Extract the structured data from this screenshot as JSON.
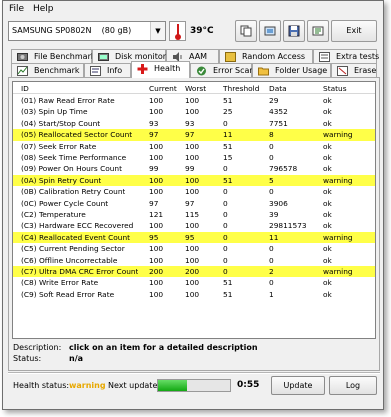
{
  "menu": {
    "file": "File",
    "help": "Help"
  },
  "toolbar": {
    "drive": "SAMSUNG SP0802N    (80 gB)",
    "temperature": "39°C",
    "exit_label": "Exit"
  },
  "tabs_row1": [
    {
      "label": "File Benchmark",
      "icon": "disk-icon"
    },
    {
      "label": "Disk monitor",
      "icon": "monitor-icon"
    },
    {
      "label": "AAM",
      "icon": "speaker-icon"
    },
    {
      "label": "Random Access",
      "icon": "random-icon"
    },
    {
      "label": "Extra tests",
      "icon": "tests-icon"
    }
  ],
  "tabs_row2": [
    {
      "label": "Benchmark",
      "icon": "benchmark-icon"
    },
    {
      "label": "Info",
      "icon": "info-icon"
    },
    {
      "label": "Health",
      "icon": "health-cross-icon"
    },
    {
      "label": "Error Scan",
      "icon": "error-scan-icon"
    },
    {
      "label": "Folder Usage",
      "icon": "folder-icon"
    },
    {
      "label": "Erase",
      "icon": "erase-icon"
    }
  ],
  "active_tab": "Health",
  "table": {
    "headers": [
      "ID",
      "Current",
      "Worst",
      "Threshold",
      "Data",
      "Status"
    ],
    "rows": [
      {
        "id": "(01) Raw Read Error Rate",
        "current": "100",
        "worst": "100",
        "threshold": "51",
        "data": "29",
        "status": "ok",
        "warn": false
      },
      {
        "id": "(03) Spin Up Time",
        "current": "100",
        "worst": "100",
        "threshold": "25",
        "data": "4352",
        "status": "ok",
        "warn": false
      },
      {
        "id": "(04) Start/Stop Count",
        "current": "93",
        "worst": "93",
        "threshold": "0",
        "data": "7751",
        "status": "ok",
        "warn": false
      },
      {
        "id": "(05) Reallocated Sector Count",
        "current": "97",
        "worst": "97",
        "threshold": "11",
        "data": "8",
        "status": "warning",
        "warn": true
      },
      {
        "id": "(07) Seek Error Rate",
        "current": "100",
        "worst": "100",
        "threshold": "51",
        "data": "0",
        "status": "ok",
        "warn": false
      },
      {
        "id": "(08) Seek Time Performance",
        "current": "100",
        "worst": "100",
        "threshold": "15",
        "data": "0",
        "status": "ok",
        "warn": false
      },
      {
        "id": "(09) Power On Hours Count",
        "current": "99",
        "worst": "99",
        "threshold": "0",
        "data": "796578",
        "status": "ok",
        "warn": false
      },
      {
        "id": "(0A) Spin Retry Count",
        "current": "100",
        "worst": "100",
        "threshold": "51",
        "data": "5",
        "status": "warning",
        "warn": true
      },
      {
        "id": "(0B) Calibration Retry Count",
        "current": "100",
        "worst": "100",
        "threshold": "0",
        "data": "0",
        "status": "ok",
        "warn": false
      },
      {
        "id": "(0C) Power Cycle Count",
        "current": "97",
        "worst": "97",
        "threshold": "0",
        "data": "3906",
        "status": "ok",
        "warn": false
      },
      {
        "id": "(C2) Temperature",
        "current": "121",
        "worst": "115",
        "threshold": "0",
        "data": "39",
        "status": "ok",
        "warn": false
      },
      {
        "id": "(C3) Hardware ECC Recovered",
        "current": "100",
        "worst": "100",
        "threshold": "0",
        "data": "29811573",
        "status": "ok",
        "warn": false
      },
      {
        "id": "(C4) Reallocated Event Count",
        "current": "95",
        "worst": "95",
        "threshold": "0",
        "data": "11",
        "status": "warning",
        "warn": true
      },
      {
        "id": "(C5) Current Pending Sector",
        "current": "100",
        "worst": "100",
        "threshold": "0",
        "data": "0",
        "status": "ok",
        "warn": false
      },
      {
        "id": "(C6) Offline Uncorrectable",
        "current": "100",
        "worst": "100",
        "threshold": "0",
        "data": "0",
        "status": "ok",
        "warn": false
      },
      {
        "id": "(C7) Ultra DMA CRC Error Count",
        "current": "200",
        "worst": "200",
        "threshold": "0",
        "data": "2",
        "status": "warning",
        "warn": true
      },
      {
        "id": "(C8) Write Error Rate",
        "current": "100",
        "worst": "100",
        "threshold": "51",
        "data": "0",
        "status": "ok",
        "warn": false
      },
      {
        "id": "(C9) Soft Read Error Rate",
        "current": "100",
        "worst": "100",
        "threshold": "51",
        "data": "1",
        "status": "ok",
        "warn": false
      }
    ]
  },
  "description": {
    "label": "Description:",
    "value": "click on an item for a detailed description",
    "status_label": "Status:",
    "status_value": "n/a"
  },
  "footer": {
    "health_label": "Health status:",
    "health_value": "warning",
    "next_update_label": "Next update:",
    "next_update_progress": 0.4,
    "timer": "0:55",
    "update_label": "Update",
    "log_label": "Log"
  },
  "colors": {
    "warning_row": "#ffff48",
    "warning_text": "#e8a800",
    "progress": "#22b022"
  }
}
